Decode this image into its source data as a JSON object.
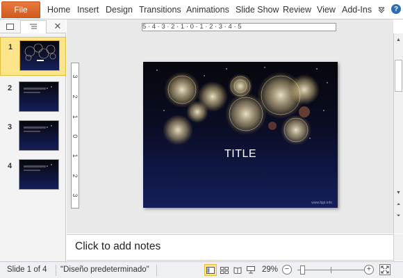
{
  "ribbon": {
    "file_label": "File",
    "tabs": [
      "Home",
      "Insert",
      "Design",
      "Transitions",
      "Animations",
      "Slide Show",
      "Review",
      "View",
      "Add-Ins"
    ],
    "icons": [
      "minimize-ribbon-icon",
      "help-icon"
    ]
  },
  "left_pane": {
    "tab_icons": [
      "slides-tab-icon",
      "outline-tab-icon"
    ],
    "close_label": "✕",
    "thumbnails": [
      {
        "number": "1",
        "selected": true
      },
      {
        "number": "2",
        "selected": false
      },
      {
        "number": "3",
        "selected": false
      },
      {
        "number": "4",
        "selected": false
      }
    ]
  },
  "ruler": {
    "horizontal_marks": "5 · 4 · 3 · 2 · 1 · 0 · 1 · 2 · 3 · 4 · 5",
    "vertical_marks": [
      "3",
      "2",
      "1",
      "0",
      "1",
      "2",
      "3"
    ]
  },
  "slide": {
    "title": "TITLE",
    "footer": "www.fppt.info",
    "colors": {
      "top": "#07070d",
      "bottom": "#141f5a",
      "firework": "#e8d8a8"
    }
  },
  "notes": {
    "placeholder": "Click to add notes"
  },
  "status": {
    "slide_indicator": "Slide 1 of 4",
    "theme_name": "\"Diseño predeterminado\"",
    "zoom": "29%",
    "zoom_fraction": 0.29,
    "view_icons": [
      "normal-view-icon",
      "slide-sorter-icon",
      "reading-view-icon",
      "slideshow-icon"
    ]
  }
}
